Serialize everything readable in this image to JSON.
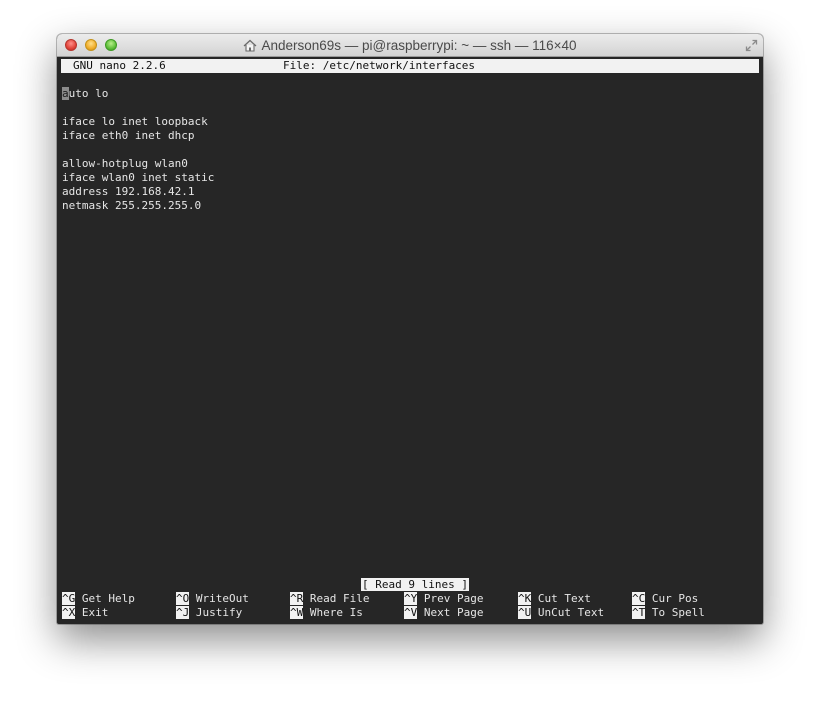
{
  "window": {
    "title": "Anderson69s — pi@raspberrypi: ~ — ssh — 116×40"
  },
  "nano": {
    "version": "GNU nano 2.2.6",
    "file_label": "File: /etc/network/interfaces",
    "status": "[ Read 9 lines ]",
    "lines": [
      "auto lo",
      "",
      "iface lo inet loopback",
      "iface eth0 inet dhcp",
      "",
      "allow-hotplug wlan0",
      "iface wlan0 inet static",
      "address 192.168.42.1",
      "netmask 255.255.255.0"
    ],
    "first_line_cursor_char": "a",
    "first_line_rest": "uto lo",
    "shortcuts_row1": [
      {
        "key": "^G",
        "label": "Get Help"
      },
      {
        "key": "^O",
        "label": "WriteOut"
      },
      {
        "key": "^R",
        "label": "Read File"
      },
      {
        "key": "^Y",
        "label": "Prev Page"
      },
      {
        "key": "^K",
        "label": "Cut Text"
      },
      {
        "key": "^C",
        "label": "Cur Pos"
      }
    ],
    "shortcuts_row2": [
      {
        "key": "^X",
        "label": "Exit"
      },
      {
        "key": "^J",
        "label": "Justify"
      },
      {
        "key": "^W",
        "label": "Where Is"
      },
      {
        "key": "^V",
        "label": "Next Page"
      },
      {
        "key": "^U",
        "label": "UnCut Text"
      },
      {
        "key": "^T",
        "label": "To Spell"
      }
    ]
  },
  "icons": {
    "close": "close-button",
    "minimize": "minimize-button",
    "zoom": "zoom-button",
    "home": "home-icon",
    "fullscreen": "fullscreen-icon"
  }
}
